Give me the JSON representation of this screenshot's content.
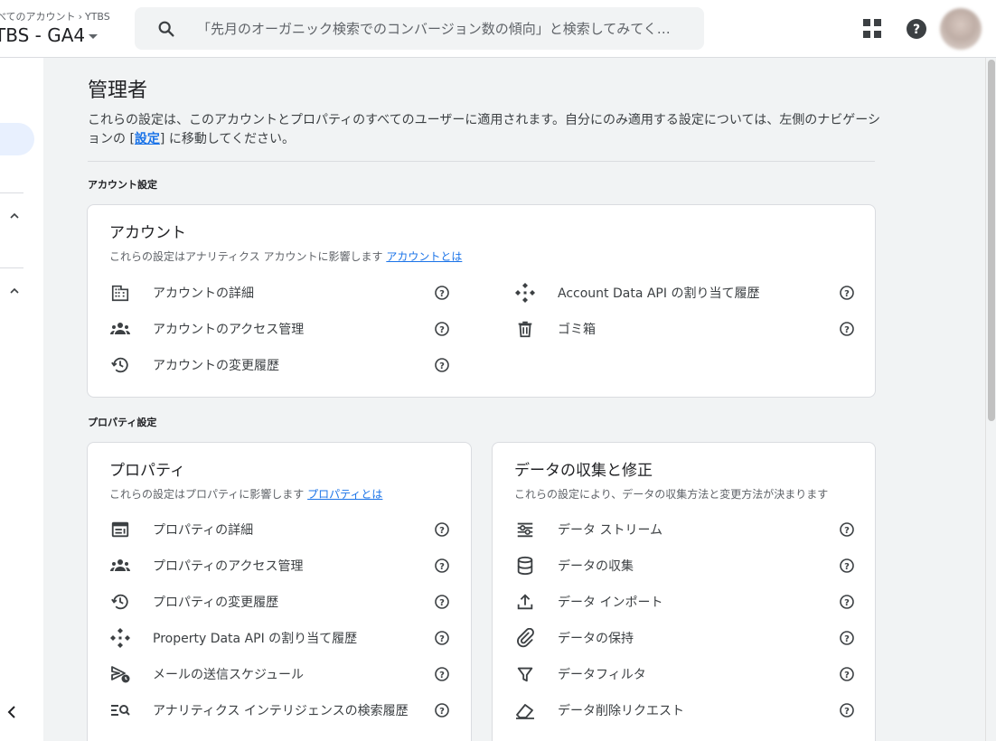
{
  "header": {
    "breadcrumb_parent": "べてのアカウント",
    "breadcrumb_child": "YTBS",
    "property_name": "TBS - GA4",
    "search_placeholder": "「先月のオーガニック検索でのコンバージョン数の傾向」と検索してみてく…",
    "icons": [
      "search-icon",
      "apps-icon",
      "help-icon",
      "avatar"
    ]
  },
  "page": {
    "title": "管理者",
    "desc_before": "これらの設定は、このアカウントとプロパティのすべてのユーザーに適用されます。自分にのみ適用する設定については、左側のナビゲーションの [",
    "desc_link": "設定",
    "desc_after": "] に移動してください。"
  },
  "account_section": {
    "label": "アカウント設定",
    "card": {
      "title": "アカウント",
      "subtitle": "これらの設定はアナリティクス アカウントに影響します",
      "subtitle_link": "アカウントとは",
      "left_items": [
        {
          "label": "アカウントの詳細",
          "icon": "building-icon"
        },
        {
          "label": "アカウントのアクセス管理",
          "icon": "group-icon"
        },
        {
          "label": "アカウントの変更履歴",
          "icon": "history-icon"
        }
      ],
      "right_items": [
        {
          "label": "Account Data API の割り当て履歴",
          "icon": "api-icon"
        },
        {
          "label": "ゴミ箱",
          "icon": "trash-icon"
        }
      ]
    }
  },
  "property_section": {
    "label": "プロパティ設定",
    "property_card": {
      "title": "プロパティ",
      "subtitle": "これらの設定はプロパティに影響します",
      "subtitle_link": "プロパティとは",
      "items": [
        {
          "label": "プロパティの詳細",
          "icon": "details-icon"
        },
        {
          "label": "プロパティのアクセス管理",
          "icon": "group-icon"
        },
        {
          "label": "プロパティの変更履歴",
          "icon": "history-icon"
        },
        {
          "label": "Property Data API の割り当て履歴",
          "icon": "api-icon"
        },
        {
          "label": "メールの送信スケジュール",
          "icon": "scheduled-send-icon"
        },
        {
          "label": "アナリティクス インテリジェンスの検索履歴",
          "icon": "search-history-icon"
        }
      ]
    },
    "data_card": {
      "title": "データの収集と修正",
      "subtitle": "これらの設定により、データの収集方法と変更方法が決まります",
      "items": [
        {
          "label": "データ ストリーム",
          "icon": "stream-icon"
        },
        {
          "label": "データの収集",
          "icon": "database-icon"
        },
        {
          "label": "データ インポート",
          "icon": "upload-icon"
        },
        {
          "label": "データの保持",
          "icon": "attach-icon"
        },
        {
          "label": "データフィルタ",
          "icon": "filter-icon"
        },
        {
          "label": "データ削除リクエスト",
          "icon": "eraser-icon"
        }
      ]
    }
  },
  "colors": {
    "accent": "#1a73e8",
    "background": "#f1f3f4",
    "card": "#ffffff",
    "text": "#202124",
    "icon": "#3c4043"
  }
}
